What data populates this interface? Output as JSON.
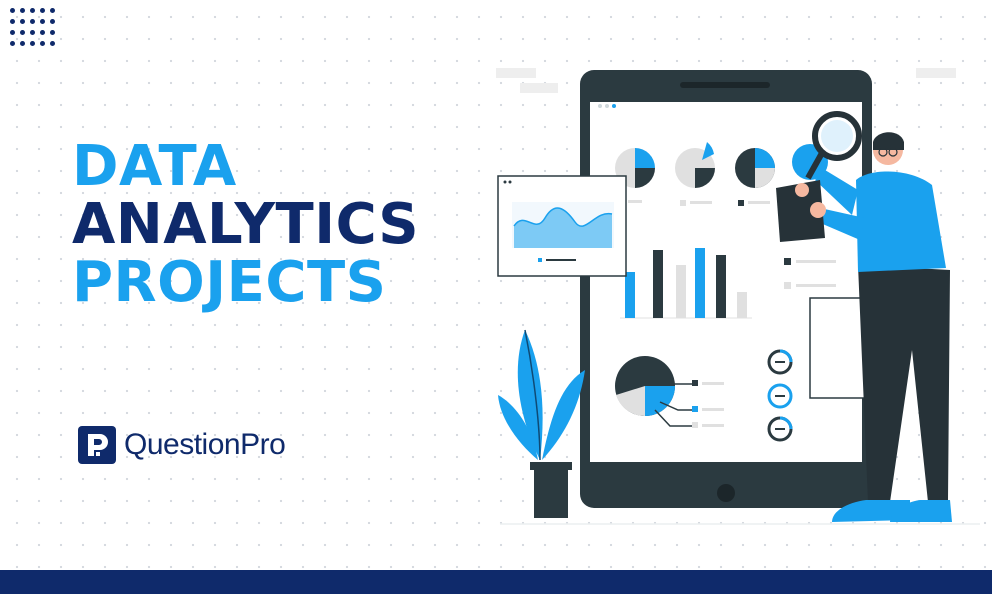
{
  "headline": {
    "line1": "DATA",
    "line2": "ANALYTICS",
    "line3": "PROJECTS"
  },
  "brand": {
    "name": "QuestionPro"
  },
  "colors": {
    "accent_blue": "#1aa1ee",
    "navy": "#0f2a6b",
    "dark_slate": "#263238",
    "background": "#ffffff"
  },
  "icons": {
    "brand_logo": "questionpro-logo-icon",
    "illustration": "analytics-tablet-illustration",
    "decor": "dot-grid-icon"
  }
}
